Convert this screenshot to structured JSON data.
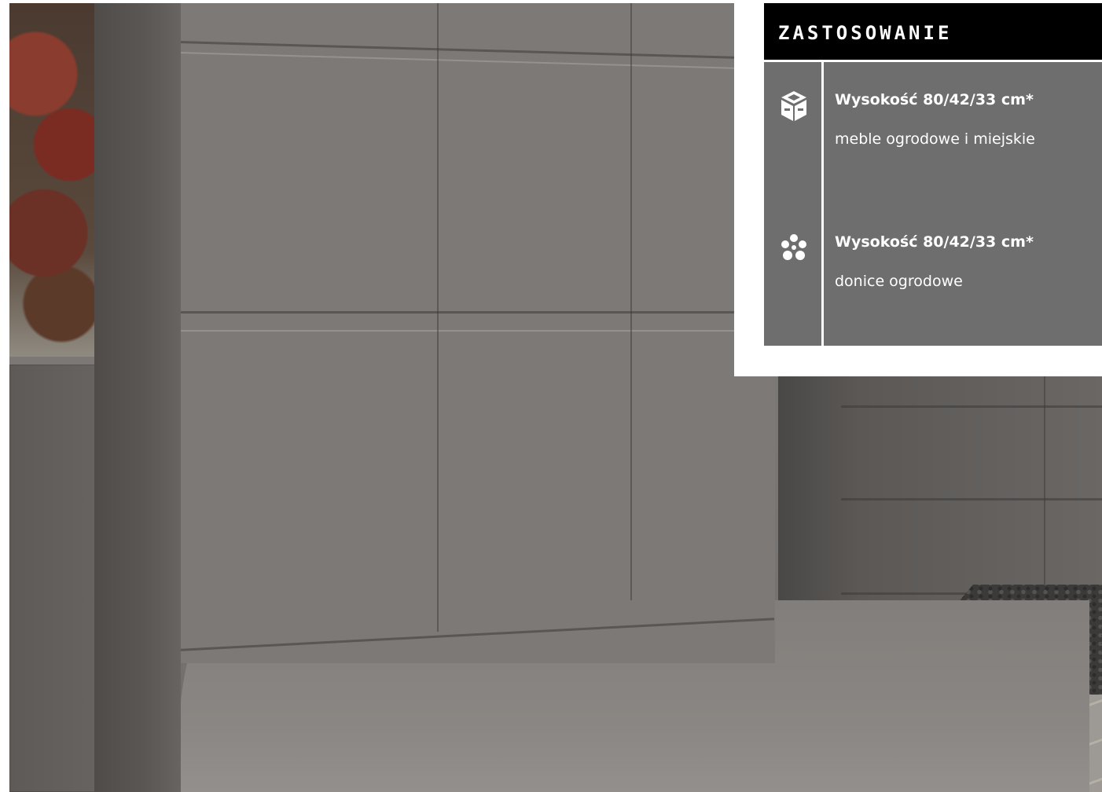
{
  "panel": {
    "header": "ZASTOSOWANIE",
    "items": [
      {
        "icon": "bench-icon",
        "title": "Wysokość 80/42/33 cm*",
        "text": "meble ogrodowe i miejskie"
      },
      {
        "icon": "flower-icon",
        "title": "Wysokość 80/42/33 cm*",
        "text": "donice ogrodowe"
      }
    ]
  },
  "colors": {
    "header_bg": "#000000",
    "panel_bg": "#6e6e6e",
    "text": "#ffffff",
    "wall": "#7d7977"
  }
}
